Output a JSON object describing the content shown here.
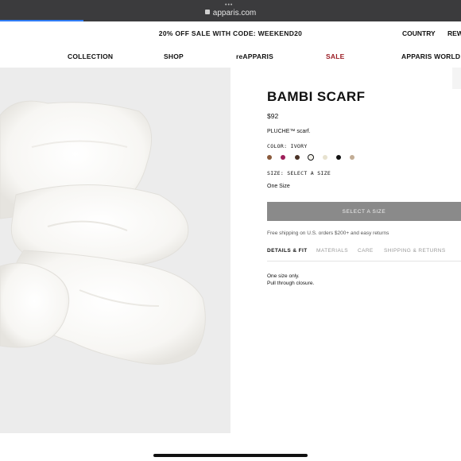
{
  "browser": {
    "url": "apparis.com"
  },
  "promo": {
    "message": "20% OFF SALE WITH CODE: WEEKEND20",
    "country": "COUNTRY",
    "rewards": "REW"
  },
  "nav": [
    {
      "label": "COLLECTION"
    },
    {
      "label": "SHOP"
    },
    {
      "label": "reAPPARIS"
    },
    {
      "label": "SALE"
    },
    {
      "label": "APPARIS WORLD"
    }
  ],
  "product": {
    "title": "BAMBI SCARF",
    "price": "$92",
    "description": "PLUCHE™ scarf.",
    "color_label": "COLOR: IVORY",
    "swatches": [
      {
        "name": "brown",
        "color": "#8a5a3c"
      },
      {
        "name": "berry",
        "color": "#9e1f5a"
      },
      {
        "name": "dark-brown",
        "color": "#4a3226"
      },
      {
        "name": "ivory",
        "color": "#f3f0e6",
        "selected": true
      },
      {
        "name": "cream",
        "color": "#e7e2cf"
      },
      {
        "name": "black",
        "color": "#111111"
      },
      {
        "name": "taupe",
        "color": "#c2ad95"
      }
    ],
    "size_label": "SIZE: SELECT A SIZE",
    "size_option": "One Size",
    "select_size_button": "SELECT A SIZE",
    "shipping_note": "Free shipping on U.S. orders $200+ and easy returns",
    "tabs": [
      {
        "label": "DETAILS & FIT",
        "active": true
      },
      {
        "label": "MATERIALS"
      },
      {
        "label": "CARE"
      },
      {
        "label": "SHIPPING & RETURNS"
      }
    ],
    "details_lines": [
      "One size only.",
      "Pull through closure."
    ]
  }
}
